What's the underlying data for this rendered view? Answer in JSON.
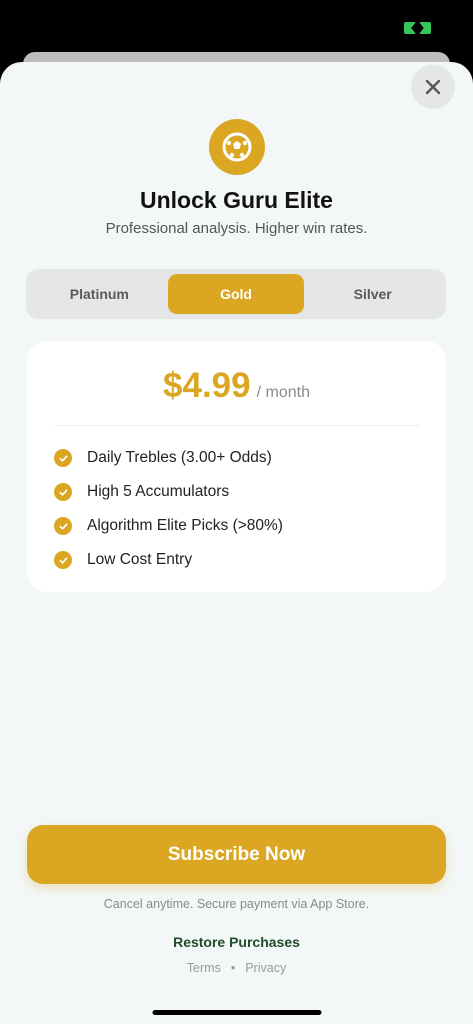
{
  "header": {
    "title": "Unlock Guru Elite",
    "subtitle": "Professional analysis. Higher win rates."
  },
  "plans": {
    "tabs": [
      {
        "label": "Platinum",
        "selected": false
      },
      {
        "label": "Gold",
        "selected": true
      },
      {
        "label": "Silver",
        "selected": false
      }
    ]
  },
  "pricing": {
    "price": "$4.99",
    "period": "/ month",
    "features": [
      "Daily Trebles (3.00+ Odds)",
      "High 5 Accumulators",
      "Algorithm Elite Picks (>80%)",
      "Low Cost Entry"
    ]
  },
  "actions": {
    "subscribe_label": "Subscribe Now",
    "fine_print": "Cancel anytime. Secure payment via App Store.",
    "restore_label": "Restore Purchases",
    "terms_label": "Terms",
    "separator": "•",
    "privacy_label": "Privacy"
  },
  "icons": {
    "close": "close-icon",
    "hero": "soccer-ball-icon",
    "check": "checkmark-icon"
  },
  "colors": {
    "accent": "#dba723",
    "background": "#f3f7f7",
    "restore": "#214a2a",
    "status_green": "#35c759"
  }
}
